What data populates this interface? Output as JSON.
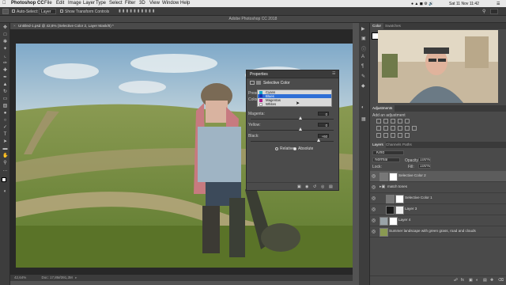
{
  "menubar": {
    "app_name": "Photoshop CC",
    "items": [
      "File",
      "Edit",
      "Image",
      "Layer",
      "Type",
      "Select",
      "Filter",
      "3D",
      "View",
      "Window",
      "Help"
    ],
    "clock": "Sat 11 Nov  11:42"
  },
  "options_bar": {
    "auto_select_label": "Auto-Select:",
    "auto_select_value": "Layer",
    "transform_label": "Show Transform Controls"
  },
  "window_title": "Adobe Photoshop CC 2018",
  "document": {
    "tab_title": "Untitled-1.psd @ 42,6% (Selective Color 2, Layer Mask/8) *",
    "zoom": "42,64%",
    "doc_info": "Doc: 17,8M/391,3M"
  },
  "properties": {
    "panel_title": "Properties",
    "adjustment_name": "Selective Color",
    "preset_label": "Preset:",
    "colors_label": "Colors:",
    "color_options": [
      "Cyans",
      "Blues",
      "Magentas",
      "Whites"
    ],
    "selected_color": "Blues",
    "sliders": [
      {
        "label": "Magenta:",
        "value": "0",
        "percent": 0.6
      },
      {
        "label": "Yellow:",
        "value": "0",
        "percent": 0.6
      },
      {
        "label": "Black:",
        "value": "+60",
        "percent": 0.82
      }
    ],
    "method_relative": "Relative",
    "method_absolute": "Absolute",
    "method_selected": "Absolute"
  },
  "right_panels": {
    "color_tabs": [
      "Color",
      "Swatches"
    ],
    "adjustments_title": "Adjustments",
    "adjustments_hint": "Add an adjustment",
    "layers_tabs": [
      "Layers",
      "Channels",
      "Paths"
    ],
    "blend_mode": "Normal",
    "opacity_label": "Opacity:",
    "opacity_value": "100%",
    "lock_label": "Lock:",
    "fill_label": "Fill:",
    "fill_value": "100%",
    "kind_label": "Kind",
    "layers": [
      {
        "name": "Selective Color 2",
        "indent": 0,
        "selected": true
      },
      {
        "name": "match tones",
        "indent": 0,
        "group": true
      },
      {
        "name": "Selective Color 1",
        "indent": 1
      },
      {
        "name": "Layer 3",
        "indent": 1
      },
      {
        "name": "Layer 4",
        "indent": 0
      },
      {
        "name": "Summer landscape with green grass, road and clouds",
        "indent": 0
      }
    ]
  },
  "colors": {
    "accent": "#3f7fd1",
    "highlight_blue": "#2f6fd6",
    "sky": "#8fb8d6"
  }
}
